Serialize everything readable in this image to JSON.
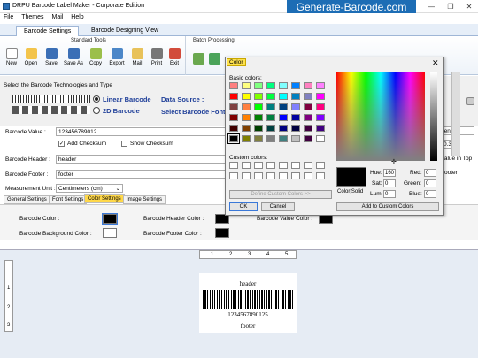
{
  "window": {
    "title": "DRPU Barcode Label Maker - Corporate Edition",
    "brand": "Generate-Barcode.com",
    "min": "—",
    "max": "❐",
    "close": "✕"
  },
  "menu": [
    "File",
    "Themes",
    "Mail",
    "Help"
  ],
  "tabs": [
    "Barcode Settings",
    "Barcode Designing View"
  ],
  "ribbon": {
    "standard_tools": "Standard Tools",
    "batch_processing": "Batch Processing",
    "buttons": [
      "New",
      "Open",
      "Save",
      "Save As",
      "Copy",
      "Export",
      "Mail",
      "Print",
      "Exit"
    ]
  },
  "tech": {
    "heading": "Select the Barcode Technologies and Type",
    "linear": "Linear Barcode",
    "twod": "2D Barcode",
    "data_source": "Data Source :",
    "font": "Select Barcode Font"
  },
  "fields": {
    "value_label": "Barcode Value :",
    "value": "123456789012",
    "add_checksum": "Add Checksum",
    "show_checksum": "Show Checksum",
    "header_label": "Barcode Header :",
    "header": "header",
    "footer_label": "Barcode Footer :",
    "footer": "footer",
    "unit_label": "Measurement Unit :",
    "unit": "Centimeters (cm)"
  },
  "right_partial": {
    "align": "Center",
    "num": "0.30",
    "value_in_top": "Value in Top",
    "footer": "Footer",
    "er": "er"
  },
  "property_tabs": [
    "General Settings",
    "Font Settings",
    "Color Settings",
    "Image Settings"
  ],
  "colors": {
    "barcode_color": "Barcode Color :",
    "bg_color": "Barcode Background Color :",
    "header_color": "Barcode Header Color :",
    "footer_color": "Barcode Footer Color :",
    "value_color": "Barcode Value Color :"
  },
  "ruler": {
    "h": [
      "1",
      "2",
      "3",
      "4",
      "5"
    ],
    "v": [
      "1",
      "2",
      "3"
    ]
  },
  "label": {
    "header": "header",
    "value": "1234567890125",
    "footer": "footer"
  },
  "dialog": {
    "title": "Color",
    "close": "✕",
    "basic": "Basic colors:",
    "custom": "Custom colors:",
    "define": "Define Custom Colors >>",
    "ok": "OK",
    "cancel": "Cancel",
    "color_solid": "Color|Solid",
    "hue_l": "Hue:",
    "hue": "160",
    "sat_l": "Sat:",
    "sat": "0",
    "lum_l": "Lum:",
    "lum": "0",
    "red_l": "Red:",
    "red": "0",
    "green_l": "Green:",
    "green": "0",
    "blue_l": "Blue:",
    "blue": "0",
    "add": "Add to Custom Colors"
  },
  "palette": [
    "#ff8080",
    "#ffff80",
    "#80ff80",
    "#00ff80",
    "#80ffff",
    "#0080ff",
    "#ff80c0",
    "#ff80ff",
    "#ff0000",
    "#ffff00",
    "#80ff00",
    "#00ff40",
    "#00ffff",
    "#0080c0",
    "#8080c0",
    "#ff00ff",
    "#804040",
    "#ff8040",
    "#00ff00",
    "#008080",
    "#004080",
    "#8080ff",
    "#800040",
    "#ff0080",
    "#800000",
    "#ff8000",
    "#008000",
    "#008040",
    "#0000ff",
    "#0000a0",
    "#800080",
    "#8000ff",
    "#400000",
    "#804000",
    "#004000",
    "#004040",
    "#000080",
    "#000040",
    "#400040",
    "#400080",
    "#000000",
    "#808000",
    "#808040",
    "#808080",
    "#408080",
    "#c0c0c0",
    "#400040",
    "#ffffff"
  ]
}
